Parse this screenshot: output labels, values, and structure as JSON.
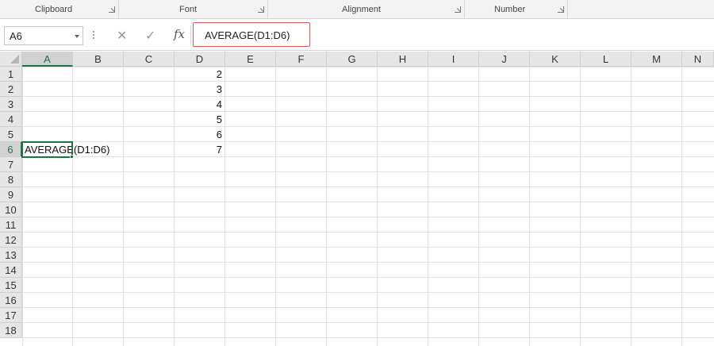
{
  "ribbon": {
    "groups": [
      {
        "label": "Clipboard"
      },
      {
        "label": "Font"
      },
      {
        "label": "Alignment"
      },
      {
        "label": "Number"
      }
    ]
  },
  "formula_bar": {
    "name_box": "A6",
    "fx_label": "fx",
    "formula": "AVERAGE(D1:D6)",
    "highlight_color": "#e05a5a"
  },
  "sheet": {
    "columns": [
      "A",
      "B",
      "C",
      "D",
      "E",
      "F",
      "G",
      "H",
      "I",
      "J",
      "K",
      "L",
      "M",
      "N"
    ],
    "rows": [
      "1",
      "2",
      "3",
      "4",
      "5",
      "6",
      "7",
      "8",
      "9",
      "10",
      "11",
      "12",
      "13",
      "14",
      "15",
      "16",
      "17",
      "18"
    ],
    "selected_cell": "A6",
    "accent_color": "#217346",
    "cells": {
      "D1": "2",
      "D2": "3",
      "D3": "4",
      "D4": "5",
      "D5": "6",
      "D6": "7",
      "A6": "AVERAGE(D1:D6)"
    }
  }
}
